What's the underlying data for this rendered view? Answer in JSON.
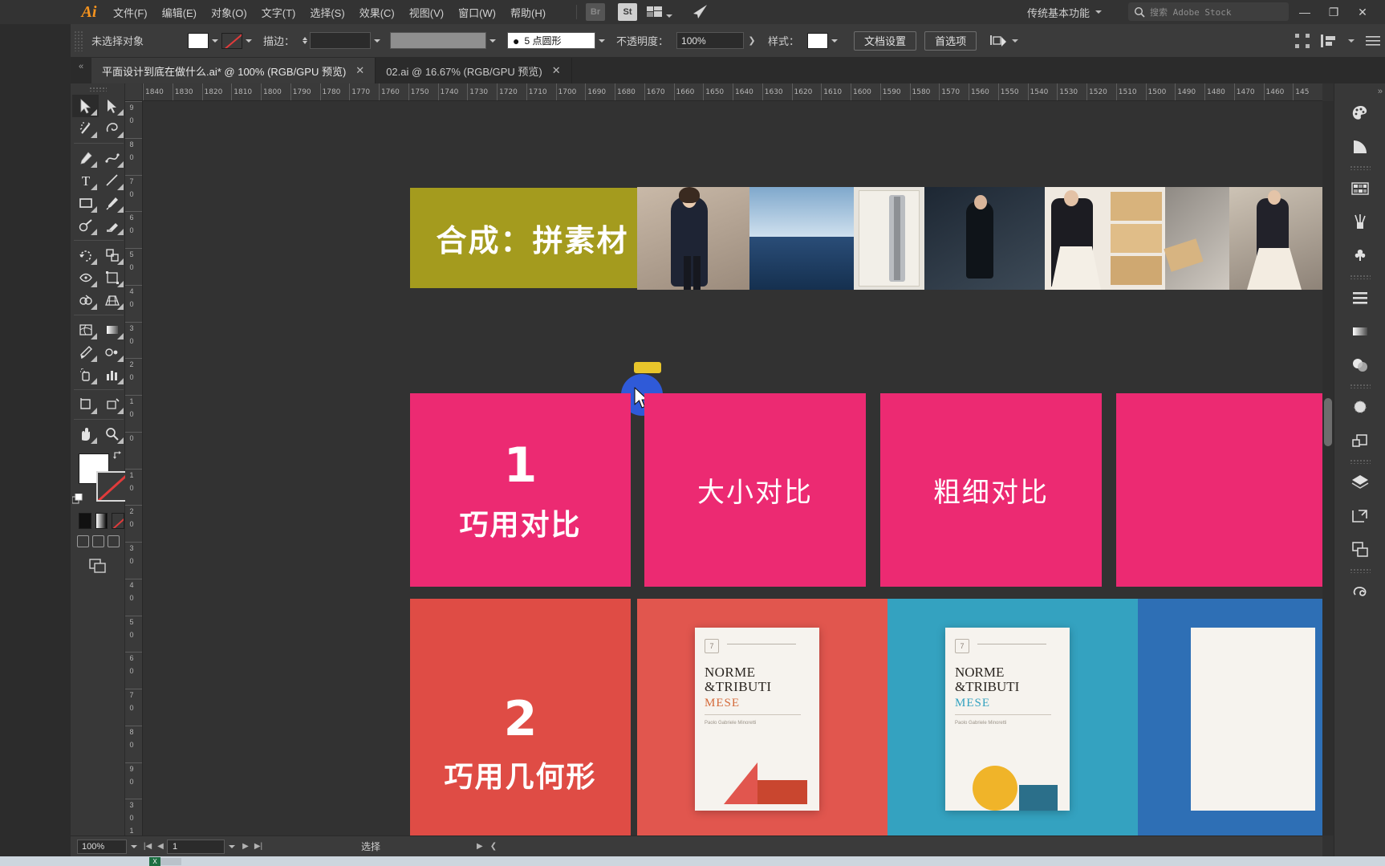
{
  "app": {
    "name": "Adobe Illustrator",
    "logo_text": "Ai",
    "workspace": "传统基本功能",
    "stock_search_placeholder": "搜索 Adobe Stock",
    "accent": "#f7941e",
    "chrome_bg": "#333333",
    "panel_bg": "#383838",
    "canvas_bg": "#323232"
  },
  "menu": {
    "items": [
      {
        "label": "文件(F)",
        "name": "menu-file"
      },
      {
        "label": "编辑(E)",
        "name": "menu-edit"
      },
      {
        "label": "对象(O)",
        "name": "menu-object"
      },
      {
        "label": "文字(T)",
        "name": "menu-type"
      },
      {
        "label": "选择(S)",
        "name": "menu-select"
      },
      {
        "label": "效果(C)",
        "name": "menu-effect"
      },
      {
        "label": "视图(V)",
        "name": "menu-view"
      },
      {
        "label": "窗口(W)",
        "name": "menu-window"
      },
      {
        "label": "帮助(H)",
        "name": "menu-help"
      }
    ],
    "bridge_label": "Br",
    "stock_label": "St"
  },
  "window_controls": {
    "minimize": "—",
    "maximize": "❐",
    "close": "✕"
  },
  "control_bar": {
    "selection_status": "未选择对象",
    "fill_color": "#ffffff",
    "stroke_color": "none",
    "stroke_label": "描边：",
    "stroke_weight": "",
    "brush_definition": "5 点圆形",
    "opacity_label": "不透明度：",
    "opacity_value": "100%",
    "style_label": "样式：",
    "document_setup": "文档设置",
    "preferences": "首选项",
    "align_label": "对齐"
  },
  "tabs": [
    {
      "label": "平面设计到底在做什么.ai* @ 100% (RGB/GPU 预览)",
      "active": true,
      "close": "✕"
    },
    {
      "label": "02.ai @ 16.67% (RGB/GPU 预览)",
      "active": false,
      "close": "✕"
    }
  ],
  "tools": [
    {
      "name": "selection-tool",
      "label": "选择工具",
      "selected": true
    },
    {
      "name": "direct-selection-tool",
      "label": "直接选择工具",
      "selected": false
    },
    {
      "name": "magic-wand-tool",
      "label": "魔棒工具",
      "selected": false
    },
    {
      "name": "lasso-tool",
      "label": "套索工具",
      "selected": false
    },
    {
      "name": "pen-tool",
      "label": "钢笔工具",
      "selected": false
    },
    {
      "name": "curvature-tool",
      "label": "曲率工具",
      "selected": false
    },
    {
      "name": "type-tool",
      "label": "文字工具",
      "selected": false
    },
    {
      "name": "line-segment-tool",
      "label": "直线段工具",
      "selected": false
    },
    {
      "name": "rectangle-tool",
      "label": "矩形工具",
      "selected": false
    },
    {
      "name": "paintbrush-tool",
      "label": "画笔工具",
      "selected": false
    },
    {
      "name": "shaper-tool",
      "label": "Shaper 工具",
      "selected": false
    },
    {
      "name": "eraser-tool",
      "label": "橡皮擦工具",
      "selected": false
    },
    {
      "name": "rotate-tool",
      "label": "旋转工具",
      "selected": false
    },
    {
      "name": "scale-tool",
      "label": "比例缩放工具",
      "selected": false
    },
    {
      "name": "width-tool",
      "label": "宽度工具",
      "selected": false
    },
    {
      "name": "free-transform-tool",
      "label": "自由变换工具",
      "selected": false
    },
    {
      "name": "shape-builder-tool",
      "label": "形状生成器工具",
      "selected": false
    },
    {
      "name": "perspective-grid-tool",
      "label": "透视网格工具",
      "selected": false
    },
    {
      "name": "mesh-tool",
      "label": "网格工具",
      "selected": false
    },
    {
      "name": "gradient-tool",
      "label": "渐变工具",
      "selected": false
    },
    {
      "name": "eyedropper-tool",
      "label": "吸管工具",
      "selected": false
    },
    {
      "name": "blend-tool",
      "label": "混合工具",
      "selected": false
    },
    {
      "name": "symbol-sprayer-tool",
      "label": "符号喷枪工具",
      "selected": false
    },
    {
      "name": "column-graph-tool",
      "label": "柱形图工具",
      "selected": false
    },
    {
      "name": "artboard-tool",
      "label": "画板工具",
      "selected": false
    },
    {
      "name": "slice-tool",
      "label": "切片工具",
      "selected": false
    },
    {
      "name": "hand-tool",
      "label": "抓手工具",
      "selected": false
    },
    {
      "name": "zoom-tool",
      "label": "缩放工具",
      "selected": false
    }
  ],
  "rulers": {
    "unit": "px",
    "h_start": 1840,
    "h_step": -10,
    "h_count": 40,
    "h_labels": [
      "1840",
      "1830",
      "1820",
      "1810",
      "1800",
      "1790",
      "1780",
      "1770",
      "1760",
      "1750",
      "1740",
      "1730",
      "1720",
      "1710",
      "1700",
      "1690",
      "1680",
      "1670",
      "1660",
      "1650",
      "1640",
      "1630",
      "1620",
      "1610",
      "1600",
      "1590",
      "1580",
      "1570",
      "1560",
      "1550",
      "1540",
      "1530",
      "1520",
      "1510",
      "1500",
      "1490",
      "1480",
      "1470",
      "1460",
      "145"
    ],
    "v_labels": [
      "9 0",
      "8 0",
      "7 0",
      "6 0",
      "5 0",
      "4 0",
      "3 0",
      "2 0",
      "1 0",
      "0",
      "1 0",
      "2 0",
      "3 0",
      "4 0",
      "5 0",
      "6 0",
      "7 0",
      "8 0",
      "9 0",
      "3 0 1"
    ]
  },
  "artboard": {
    "cards": [
      {
        "name": "card-composite",
        "text": "合成：拼素材",
        "color": "#a49b1e",
        "text_color": "#ffffff",
        "font_size": 38
      },
      {
        "name": "card-contrast-number",
        "text": "1",
        "color": "#ec2a72",
        "text_color": "#ffffff",
        "font_size": 60
      },
      {
        "name": "card-contrast-title",
        "text": "巧用对比",
        "color": "#ec2a72",
        "text_color": "#ffffff",
        "font_size": 36
      },
      {
        "name": "card-size-contrast",
        "text": "大小对比",
        "color": "#ec2a72",
        "text_color": "#ffffff",
        "font_size": 34
      },
      {
        "name": "card-weight-contrast",
        "text": "粗细对比",
        "color": "#ec2a72",
        "text_color": "#ffffff",
        "font_size": 34
      },
      {
        "name": "card-geometry-number",
        "text": "2",
        "color": "#df4c45",
        "text_color": "#ffffff",
        "font_size": 60
      },
      {
        "name": "card-geometry-title",
        "text": "巧用几何形",
        "color": "#df4c45",
        "text_color": "#ffffff",
        "font_size": 36
      }
    ],
    "poster_text": {
      "line1": "NORME",
      "line2": "&TRIBUTI",
      "line3": "MESE",
      "accent": "#2f9fc4"
    }
  },
  "status_bar": {
    "zoom": "100%",
    "artboard_number": "1",
    "tool_status": "选择",
    "first_label": "|◀",
    "prev_label": "◀",
    "next_label": "▶",
    "last_label": "▶|"
  },
  "right_dock": {
    "items": [
      {
        "name": "color-panel-icon",
        "label": "颜色"
      },
      {
        "name": "color-guide-panel-icon",
        "label": "颜色参考"
      },
      {
        "name": "swatches-panel-icon",
        "label": "色板"
      },
      {
        "name": "brushes-panel-icon",
        "label": "画笔"
      },
      {
        "name": "symbols-panel-icon",
        "label": "符号"
      },
      {
        "name": "align-panel-icon",
        "label": "对齐"
      },
      {
        "name": "gradient-panel-icon",
        "label": "渐变"
      },
      {
        "name": "transparency-panel-icon",
        "label": "透明度"
      },
      {
        "name": "appearance-panel-icon",
        "label": "外观"
      },
      {
        "name": "pathfinder-panel-icon",
        "label": "路径查找器"
      },
      {
        "name": "layers-panel-icon",
        "label": "图层"
      },
      {
        "name": "artboards-panel-icon",
        "label": "画板"
      },
      {
        "name": "asset-export-panel-icon",
        "label": "资源导出"
      },
      {
        "name": "libraries-panel-icon",
        "label": "库"
      }
    ],
    "collapse": "»"
  },
  "taskbar": {
    "excel_badge": "X"
  }
}
